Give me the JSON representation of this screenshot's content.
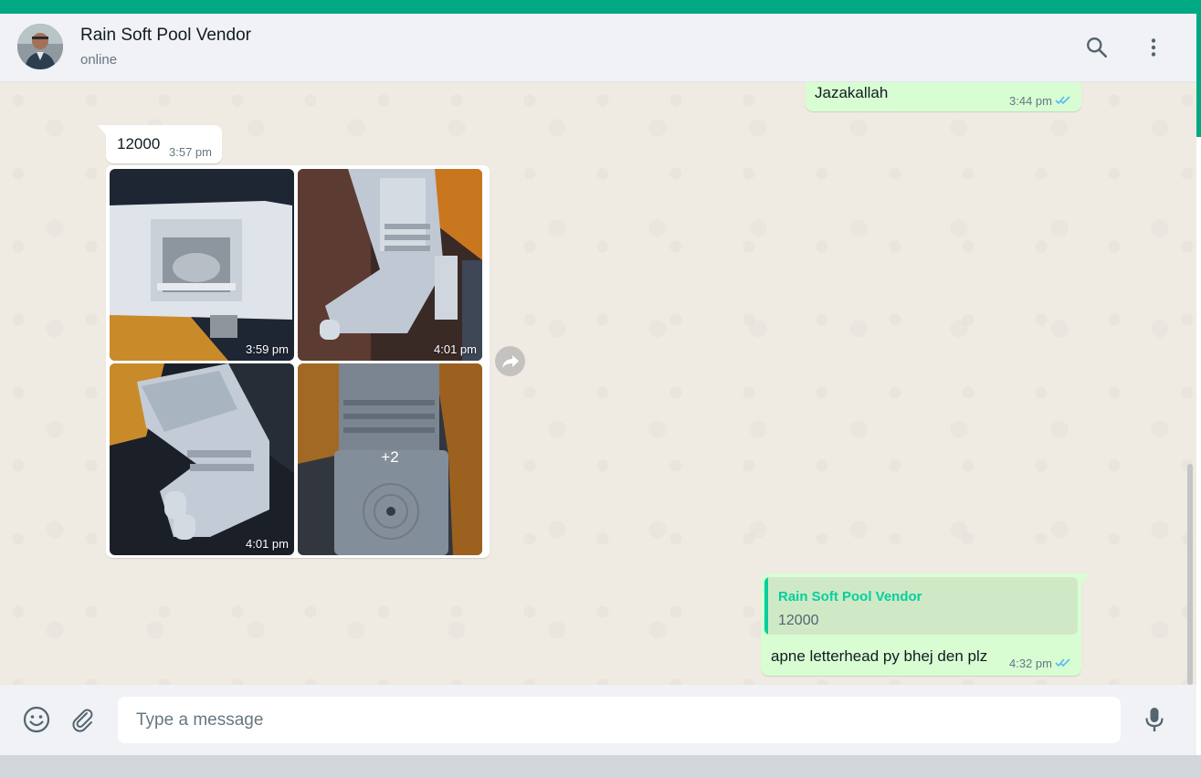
{
  "header": {
    "contact_name": "Rain Soft Pool Vendor",
    "status": "online",
    "icons": [
      "search-icon",
      "menu-icon"
    ]
  },
  "messages": {
    "top_partial": {
      "text": "Jazakallah",
      "time": "3:44 pm",
      "status": "read"
    },
    "price": {
      "text": "12000",
      "time": "3:57 pm"
    },
    "album": {
      "photos": [
        {
          "time": "3:59 pm"
        },
        {
          "time": "4:01 pm"
        },
        {
          "time": "4:01 pm"
        },
        {
          "more_count": "+2"
        }
      ]
    },
    "reply": {
      "quoted_author": "Rain Soft Pool Vendor",
      "quoted_text": "12000",
      "text": "apne letterhead py bhej den plz",
      "time": "4:32 pm",
      "status": "read"
    }
  },
  "composer": {
    "placeholder": "Type a message",
    "icons": [
      "emoji-icon",
      "attach-icon",
      "microphone-icon"
    ]
  },
  "colors": {
    "accent": "#00a884",
    "outgoing_bubble": "#d9fdd3",
    "incoming_bubble": "#ffffff",
    "read_ticks": "#53bdeb",
    "quote_author": "#06cf9c"
  }
}
